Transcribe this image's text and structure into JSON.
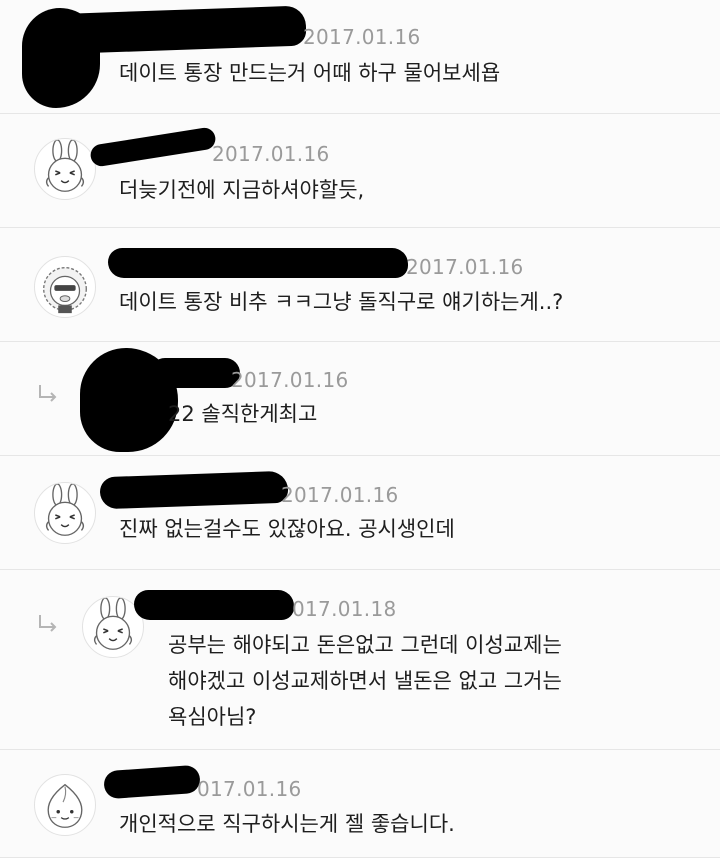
{
  "comments": [
    {
      "date": "2017.01.16",
      "text": "데이트 통장 만드는거 어때 하구 물어보세욥",
      "avatar": "user-avatar-redacted"
    },
    {
      "date": "2017.01.16",
      "text": "더늦기전에 지금하셔야할듯,",
      "avatar": "rabbit-avatar-icon"
    },
    {
      "date": "2017.01.16",
      "text": "데이트 통장 비추 ㅋㅋ그냥 돌직구로 얘기하는게..?",
      "avatar": "lion-avatar-icon"
    },
    {
      "date": "2017.01.16",
      "text": "22 솔직한게최고",
      "avatar": "user-avatar-redacted",
      "reply": true
    },
    {
      "date": "2017.01.16",
      "text": "진짜 없는걸수도 있잖아요. 공시생인데",
      "avatar": "rabbit-avatar-icon"
    },
    {
      "date": "017.01.18",
      "lines": [
        "공부는 해야되고 돈은없고 그런데 이성교제는",
        "해야겠고 이성교제하면서 낼돈은 없고 그거는",
        "욕심아님?"
      ],
      "avatar": "rabbit-avatar-icon",
      "reply": true
    },
    {
      "date": "017.01.16",
      "text": "개인적으로 직구하시는게 젤 좋습니다.",
      "avatar": "peach-avatar-icon"
    }
  ],
  "colors": {
    "background": "#fbfbfb",
    "divider": "#e6e6e6",
    "date": "#9a9a9a",
    "text": "#1e1e1e",
    "redaction": "#000000"
  }
}
